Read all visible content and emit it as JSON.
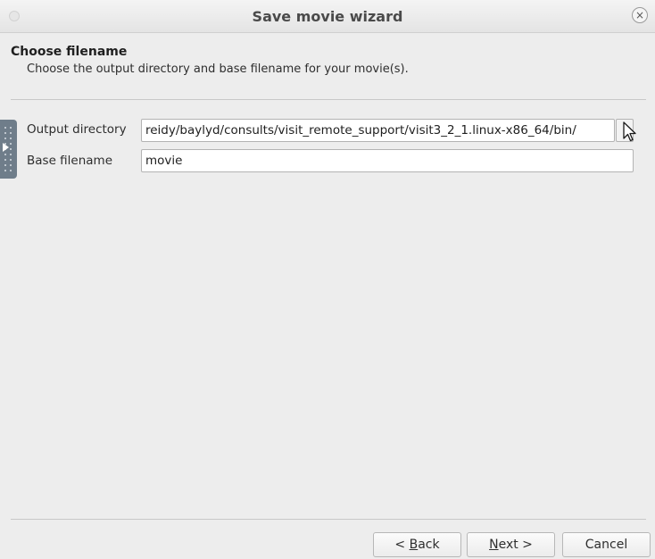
{
  "window": {
    "title": "Save movie wizard",
    "close_glyph": "×"
  },
  "page": {
    "heading": "Choose filename",
    "subheading": "Choose the output directory and base filename for your movie(s)."
  },
  "form": {
    "output_directory": {
      "label": "Output directory",
      "value": "reidy/baylyd/consults/visit_remote_support/visit3_2_1.linux-x86_64/bin/",
      "browse_label": "."
    },
    "base_filename": {
      "label": "Base filename",
      "value": "movie"
    }
  },
  "buttons": {
    "back": {
      "mnemonic": "B",
      "label_before": "< ",
      "label_after": "ack"
    },
    "next": {
      "mnemonic": "N",
      "label_before": "",
      "label_after": "ext >"
    },
    "cancel": {
      "label": "Cancel"
    }
  },
  "icons": {
    "window_icon": "window-icon",
    "close": "close-icon",
    "side_panel_toggle": "side-panel-toggle-icon",
    "cursor": "mouse-cursor-icon"
  },
  "colors": {
    "window_bg": "#ededed",
    "side_handle": "#6f7d8a",
    "separator": "#c8c8c8"
  }
}
